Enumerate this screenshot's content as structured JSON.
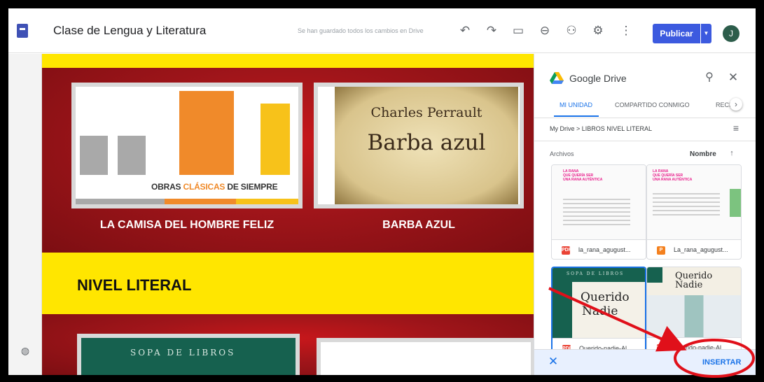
{
  "topbar": {
    "doc_title": "Clase de Lengua y Literatura",
    "save_status": "Se han guardado todos los cambios en Drive",
    "publish_label": "Publicar",
    "avatar_initial": "J"
  },
  "canvas": {
    "cards": [
      {
        "caption": "LA CAMISA DEL HOMBRE FELIZ",
        "cover_text_before": "OBRAS ",
        "cover_text_accent": "CLÁSICAS",
        "cover_text_after": " DE SIEMPRE"
      },
      {
        "caption": "BARBA AZUL",
        "cover_author": "Charles Perrault",
        "cover_title": "Barba azul"
      }
    ],
    "section_title": "NIVEL LITERAL",
    "bottom_card_text": "SOPA DE LIBROS"
  },
  "drive": {
    "title": "Google Drive",
    "tabs": [
      "MI UNIDAD",
      "COMPARTIDO CONMIGO",
      "RECI"
    ],
    "breadcrumb": "My Drive  >  LIBROS NIVEL LITERAL",
    "files_heading": "Archivos",
    "sort_label": "Nombre",
    "files": [
      {
        "name": "la_rana_agugust...",
        "type": "PDF",
        "color": "#ea4335",
        "thumb_lines": [
          "LA RANA",
          "QUE QUERÍA SER",
          "UNA RANA AUTÉNTICA"
        ]
      },
      {
        "name": "La_rana_agugust...",
        "type": "P",
        "color": "#f4811f",
        "thumb_lines": [
          "LA RANA",
          "QUE QUERÍA SER",
          "UNA RANA AUTÉNTICA"
        ]
      },
      {
        "name": "Querido-nadie-Al...",
        "type": "PDF",
        "color": "#ea4335",
        "cover_series": "SOPA DE LIBROS",
        "cover_title_1": "Querido",
        "cover_title_2": "Nadie"
      },
      {
        "name": "Querido-nadie-Al...",
        "type": "PDF",
        "color": "#ea4335",
        "cover_title": "Querido\nNadie"
      }
    ],
    "insert_label": "INSERTAR"
  },
  "colors": {
    "accent": "#1a73e8",
    "publish": "#3c5adf",
    "banner_red": "#a0151a",
    "banner_yellow": "#ffe600",
    "annotation_red": "#e0101a"
  },
  "icons": [
    "undo-icon",
    "redo-icon",
    "preview-icon",
    "link-icon",
    "share-icon",
    "settings-icon",
    "more-icon",
    "search-icon",
    "close-icon",
    "list-view-icon",
    "sort-arrow-icon",
    "palette-icon"
  ]
}
